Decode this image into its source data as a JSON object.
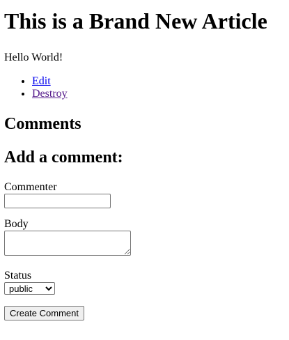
{
  "article": {
    "title": "This is a Brand New Article",
    "body": "Hello World!"
  },
  "actions": {
    "edit_label": "Edit",
    "destroy_label": "Destroy"
  },
  "comments": {
    "heading": "Comments"
  },
  "comment_form": {
    "heading": "Add a comment:",
    "commenter_label": "Commenter",
    "commenter_value": "",
    "body_label": "Body",
    "body_value": "",
    "status_label": "Status",
    "status_selected": "public",
    "status_options": [
      "public"
    ],
    "submit_label": "Create Comment"
  },
  "colors": {
    "link": "#0000ee",
    "visited_link": "#551a8b",
    "button_bg": "#efefef",
    "border": "#767676"
  }
}
